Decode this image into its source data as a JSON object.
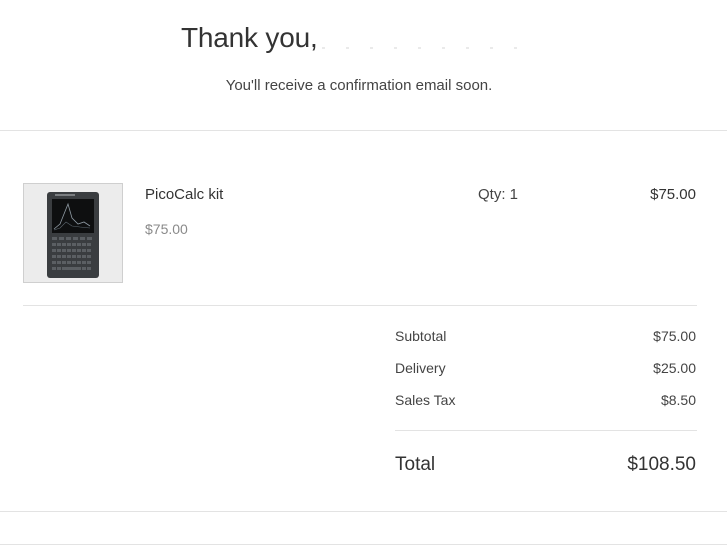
{
  "header": {
    "thank_you": "Thank you,",
    "confirmation_message": "You'll receive a confirmation email soon."
  },
  "order": {
    "items": [
      {
        "name": "PicoCalc kit",
        "unit_price": "$75.00",
        "quantity_label": "Qty: 1",
        "line_total": "$75.00",
        "image_icon": "handheld-calculator-device"
      }
    ]
  },
  "summary": {
    "subtotal_label": "Subtotal",
    "subtotal_value": "$75.00",
    "delivery_label": "Delivery",
    "delivery_value": "$25.00",
    "tax_label": "Sales Tax",
    "tax_value": "$8.50",
    "total_label": "Total",
    "total_value": "$108.50"
  },
  "colors": {
    "text": "#333333",
    "muted": "#8a8a8a",
    "divider": "#e3e3e3",
    "thumb_bg": "#ececec"
  }
}
